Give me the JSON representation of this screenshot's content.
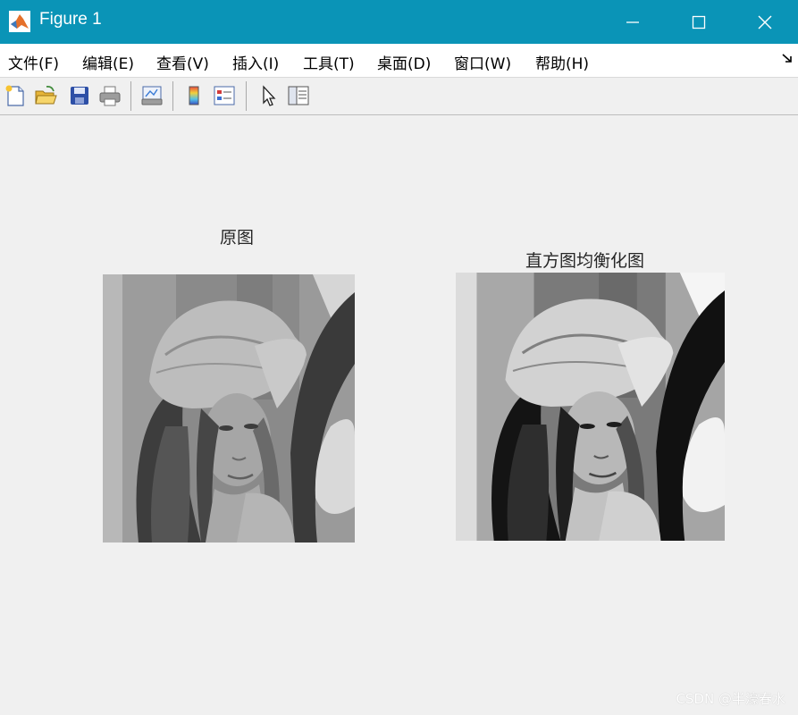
{
  "window": {
    "title": "Figure 1"
  },
  "menu": [
    "文件(F)",
    "编辑(E)",
    "查看(V)",
    "插入(I)",
    "工具(T)",
    "桌面(D)",
    "窗口(W)",
    "帮助(H)"
  ],
  "toolbar": [
    "new-figure-icon",
    "open-file-icon",
    "save-icon",
    "print-icon",
    "print-preview-icon",
    "insert-colorbar-icon",
    "insert-legend-icon",
    "edit-plot-icon",
    "property-inspector-icon"
  ],
  "axes": [
    {
      "title": "原图"
    },
    {
      "title": "直方图均衡化图"
    }
  ],
  "watermark": "CSDN @半濠春水"
}
